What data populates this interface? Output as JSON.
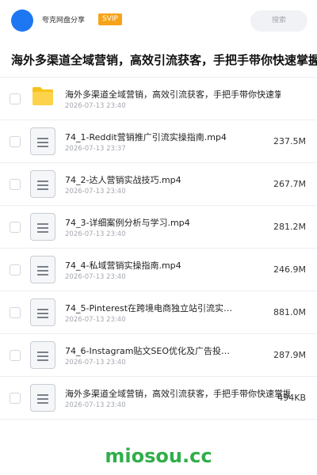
{
  "header": {
    "brand": "夸克网盘分享",
    "badge": "SVIP",
    "search_placeholder": "搜索",
    "accent_color": "#1e77f2",
    "badge_color": "#f6a31a"
  },
  "folder_title": "海外多渠道全域营销，高效引流获客，手把手带你快速掌握",
  "files": [
    {
      "type": "folder",
      "name": "海外多渠道全域营销，高效引流获客，手把手带你快速掌…",
      "date": "2026-07-13 23:40",
      "size": ""
    },
    {
      "type": "file",
      "name": "74_1-Reddit营销推广引流实操指南.mp4",
      "date": "2026-07-13 23:37",
      "size": "237.5M"
    },
    {
      "type": "file",
      "name": "74_2-达人营销实战技巧.mp4",
      "date": "2026-07-13 23:40",
      "size": "267.7M"
    },
    {
      "type": "file",
      "name": "74_3-详细案例分析与学习.mp4",
      "date": "2026-07-13 23:40",
      "size": "281.2M"
    },
    {
      "type": "file",
      "name": "74_4-私域营销实操指南.mp4",
      "date": "2026-07-13 23:40",
      "size": "246.9M"
    },
    {
      "type": "file",
      "name": "74_5-Pinterest在跨境电商独立站引流实…",
      "date": "2026-07-13 23:40",
      "size": "881.0M"
    },
    {
      "type": "file",
      "name": "74_6-Instagram贴文SEO优化及广告投…",
      "date": "2026-07-13 23:40",
      "size": "287.9M"
    },
    {
      "type": "file",
      "name": "海外多渠道全域营销，高效引流获客，手把手带你快速掌握",
      "date": "2026-07-13 23:40",
      "size": "494KB"
    }
  ],
  "watermark": "miosou.cc"
}
